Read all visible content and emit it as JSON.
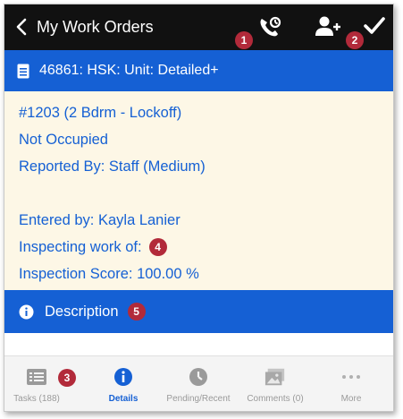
{
  "header": {
    "title": "My Work Orders",
    "badges": [
      "1",
      "2"
    ]
  },
  "work_order": {
    "title": "46861: HSK: Unit: Detailed+"
  },
  "details": {
    "unit": "#1203 (2 Bdrm - Lockoff)",
    "occupancy": "Not Occupied",
    "reported_by": "Reported By: Staff  (Medium)",
    "entered_by": "Entered by: Kayla Lanier",
    "inspecting": "Inspecting work of:",
    "inspecting_badge": "4",
    "score": "Inspection Score: 100.00 %"
  },
  "description": {
    "label": "Description",
    "badge": "5"
  },
  "tabs": [
    {
      "label": "Tasks (188)",
      "icon": "list-icon",
      "badge": "3"
    },
    {
      "label": "Details",
      "icon": "info-icon",
      "active": true
    },
    {
      "label": "Pending/Recent",
      "icon": "clock-icon"
    },
    {
      "label": "Comments (0)",
      "icon": "image-icon"
    },
    {
      "label": "More",
      "icon": "ellipsis-icon"
    }
  ],
  "colors": {
    "topbar": "#111111",
    "primary_blue": "#1560d4",
    "details_bg": "#fdf7e6",
    "badge_red": "#b22a3a"
  }
}
